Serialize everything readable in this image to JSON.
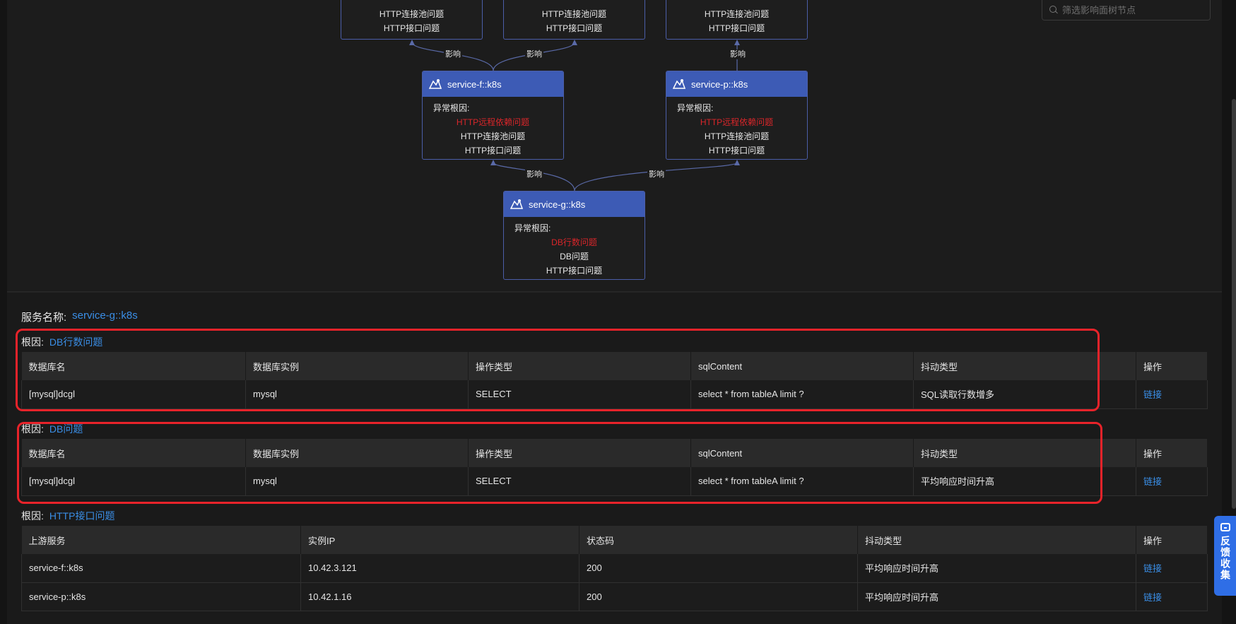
{
  "filter": {
    "placeholder": "筛选影响面树节点"
  },
  "nodes": {
    "top1": {
      "items": [
        "HTTP连接池问题",
        "HTTP接口问题"
      ]
    },
    "top2": {
      "items": [
        "HTTP连接池问题",
        "HTTP接口问题"
      ]
    },
    "top3": {
      "items": [
        "HTTP连接池问题",
        "HTTP接口问题"
      ]
    },
    "f": {
      "name": "service-f::k8s",
      "label": "异常根因:",
      "red": "HTTP远程依赖问题",
      "items": [
        "HTTP连接池问题",
        "HTTP接口问题"
      ]
    },
    "p": {
      "name": "service-p::k8s",
      "label": "异常根因:",
      "red": "HTTP远程依赖问题",
      "items": [
        "HTTP连接池问题",
        "HTTP接口问题"
      ]
    },
    "g": {
      "name": "service-g::k8s",
      "label": "异常根因:",
      "red": "DB行数问题",
      "items": [
        "DB问题",
        "HTTP接口问题"
      ]
    }
  },
  "edge_label": "影响",
  "detail": {
    "service_key": "服务名称:",
    "service_value": "service-g::k8s",
    "root_key": "根因:",
    "sections": [
      {
        "root": "DB行数问题",
        "headers": [
          "数据库名",
          "数据库实例",
          "操作类型",
          "sqlContent",
          "抖动类型",
          "操作"
        ],
        "rows": [
          [
            "[mysql]dcgl",
            "mysql",
            "SELECT",
            "select * from tableA limit ?",
            "SQL读取行数增多",
            "链接"
          ]
        ]
      },
      {
        "root": "DB问题",
        "headers": [
          "数据库名",
          "数据库实例",
          "操作类型",
          "sqlContent",
          "抖动类型",
          "操作"
        ],
        "rows": [
          [
            "[mysql]dcgl",
            "mysql",
            "SELECT",
            "select * from tableA limit ?",
            "平均响应时间升高",
            "链接"
          ]
        ]
      },
      {
        "root": "HTTP接口问题",
        "headers": [
          "上游服务",
          "实例IP",
          "状态码",
          "抖动类型",
          "操作"
        ],
        "rows": [
          [
            "service-f::k8s",
            "10.42.3.121",
            "200",
            "平均响应时间升高",
            "链接"
          ],
          [
            "service-p::k8s",
            "10.42.1.16",
            "200",
            "平均响应时间升高",
            "链接"
          ]
        ]
      }
    ]
  },
  "feedback": {
    "label": "反馈收集",
    "icon": "feedback-icon"
  },
  "colors": {
    "node_header": "#3d5bb5",
    "link": "#3a8ee6",
    "alert_red": "#d9262a",
    "highlight": "#e8232a",
    "feedback_bg": "#2f6ee6"
  }
}
